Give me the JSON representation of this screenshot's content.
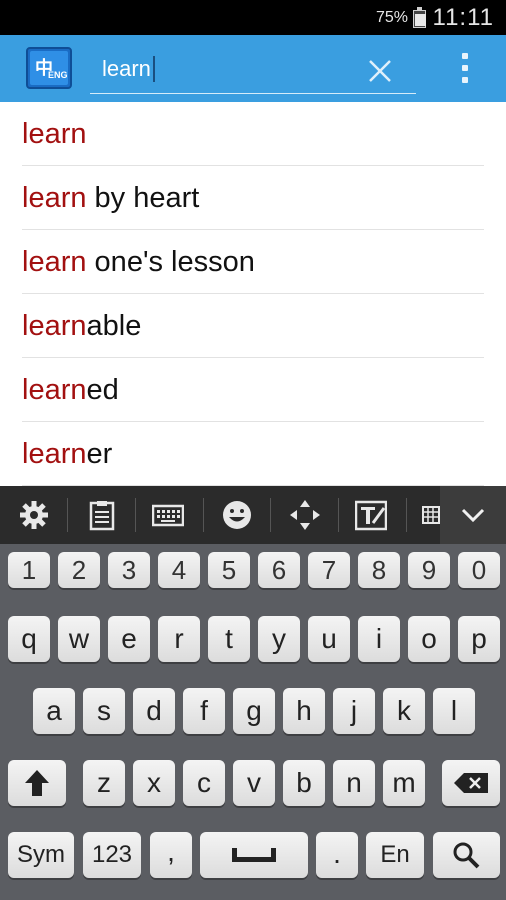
{
  "status_bar": {
    "battery_percent": "75%",
    "time": "11:11"
  },
  "app_bar": {
    "logo_text_zh": "中",
    "logo_text_eng": "ENG",
    "search_value": "learn",
    "icons": [
      "app-logo-icon",
      "clear-icon",
      "overflow-menu-icon"
    ]
  },
  "results": [
    {
      "highlight": "learn",
      "rest": ""
    },
    {
      "highlight": "learn",
      "rest": " by heart"
    },
    {
      "highlight": "learn",
      "rest": " one's lesson"
    },
    {
      "highlight": "learn",
      "rest": "able"
    },
    {
      "highlight": "learn",
      "rest": "ed"
    },
    {
      "highlight": "learn",
      "rest": "er"
    }
  ],
  "keyboard_toolbar": {
    "icons": [
      "settings-icon",
      "clipboard-icon",
      "keyboard-icon",
      "emoji-icon",
      "move-cursor-icon",
      "handwriting-icon",
      "grid-icon",
      "collapse-chevron-icon"
    ]
  },
  "keyboard": {
    "row_numbers": [
      "1",
      "2",
      "3",
      "4",
      "5",
      "6",
      "7",
      "8",
      "9",
      "0"
    ],
    "row_1": [
      "q",
      "w",
      "e",
      "r",
      "t",
      "y",
      "u",
      "i",
      "o",
      "p"
    ],
    "row_2": [
      "a",
      "s",
      "d",
      "f",
      "g",
      "h",
      "j",
      "k",
      "l"
    ],
    "row_3": [
      "z",
      "x",
      "c",
      "v",
      "b",
      "n",
      "m"
    ],
    "sym_label": "Sym",
    "num_label": "123",
    "comma_label": ",",
    "period_label": ".",
    "lang_label": "En"
  },
  "colors": {
    "app_bar": "#3a9ee0",
    "highlight": "#a21010",
    "keyboard_bg": "#5b5d62",
    "toolbar_bg": "#2b2b2b"
  }
}
